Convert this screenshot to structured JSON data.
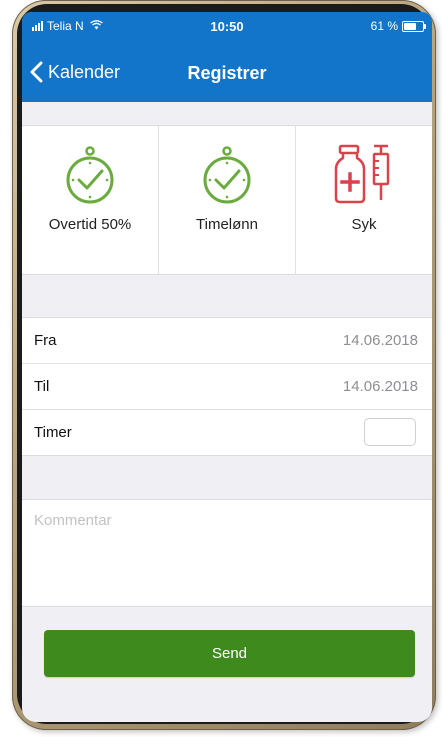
{
  "status_bar": {
    "carrier": "Telia N",
    "time": "10:50",
    "battery": "61 %",
    "battery_level": 0.61
  },
  "nav": {
    "back_label": "Kalender",
    "title": "Registrer"
  },
  "types": [
    {
      "label": "Overtid 50%",
      "icon": "stopwatch-check-icon"
    },
    {
      "label": "Timelønn",
      "icon": "stopwatch-check-icon"
    },
    {
      "label": "Syk",
      "icon": "medicine-syringe-icon"
    }
  ],
  "form": {
    "fra_label": "Fra",
    "fra_value": "14.06.2018",
    "til_label": "Til",
    "til_value": "14.06.2018",
    "timer_label": "Timer",
    "timer_value": ""
  },
  "comment": {
    "placeholder": "Kommentar"
  },
  "send_label": "Send",
  "colors": {
    "header_blue": "#1275c9",
    "accent_green": "#6aab3e",
    "send_green": "#3f8a1c",
    "sick_red": "#d9434b"
  }
}
